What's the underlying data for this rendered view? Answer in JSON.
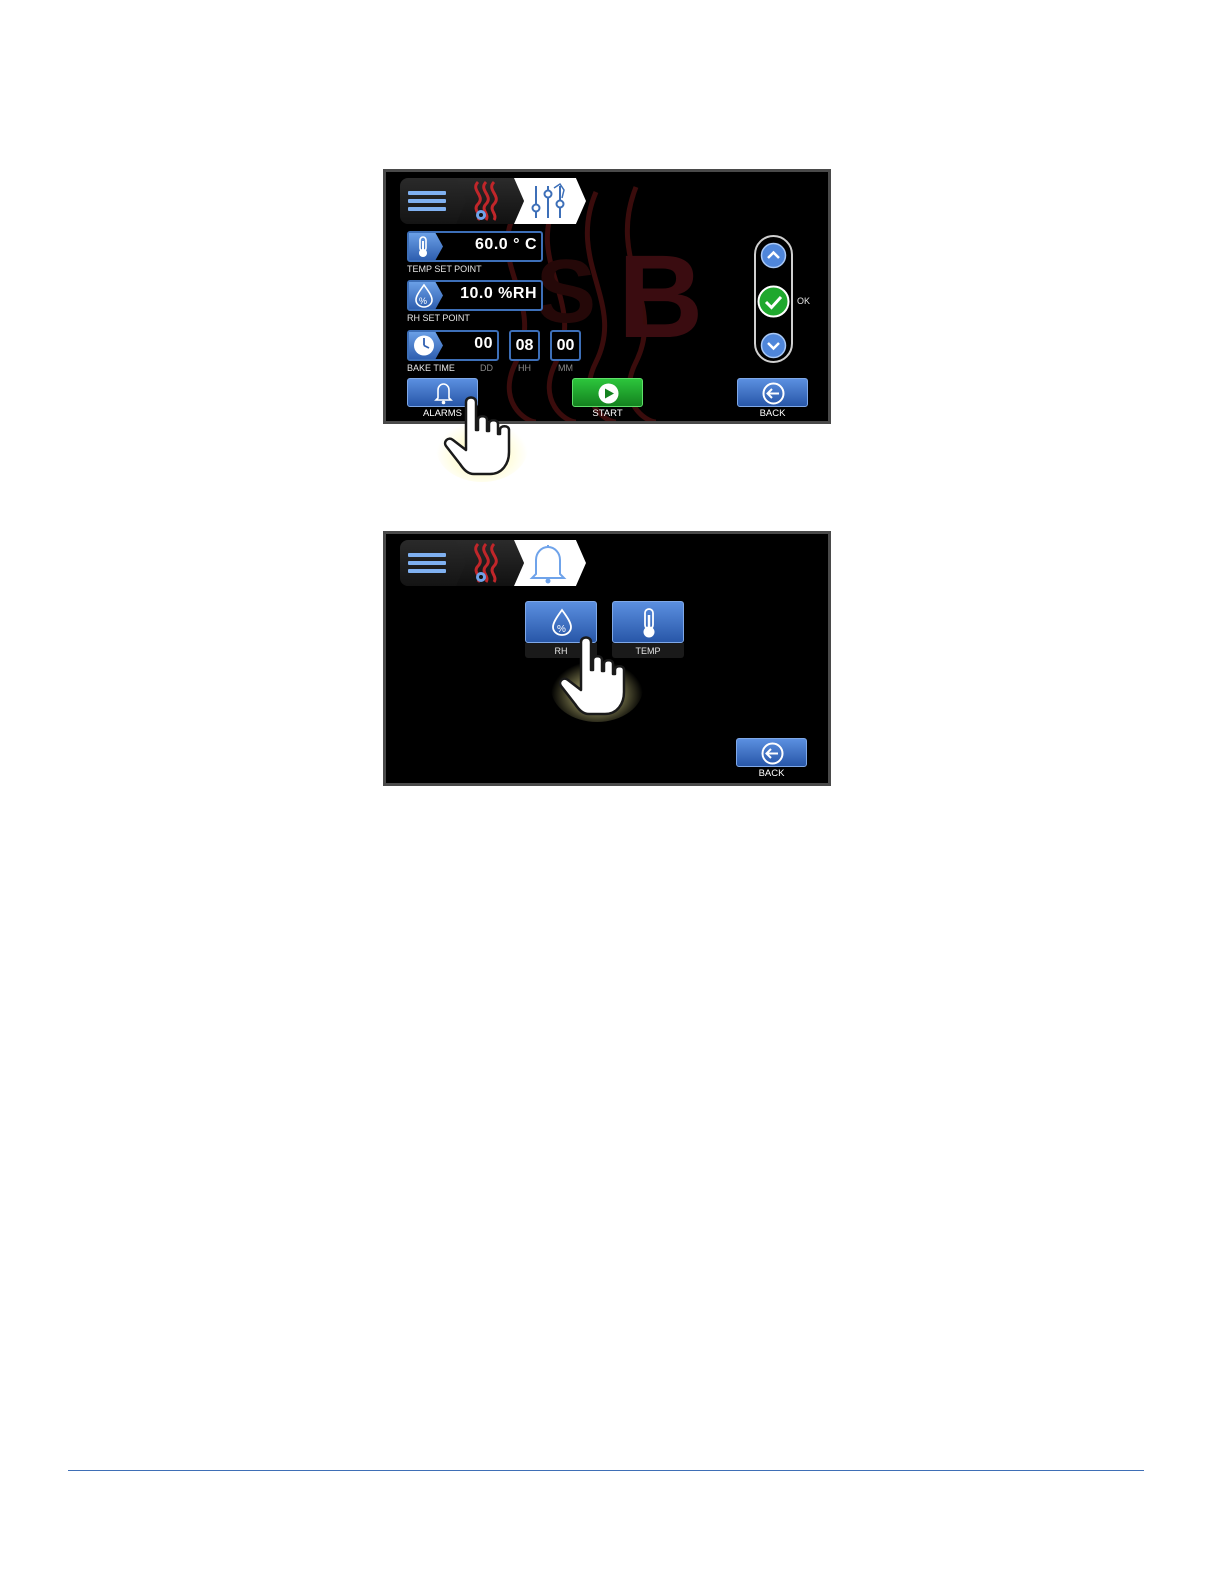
{
  "screen1": {
    "breadcrumb": {
      "menu_icon": "hamburger-menu-icon",
      "heat_icon": "heat-settings-icon",
      "active_icon": "manual-settings-icon"
    },
    "temp": {
      "value": "60.0 ° C",
      "label": "TEMP SET POINT",
      "icon": "thermometer-icon"
    },
    "rh": {
      "value": "10.0 %RH",
      "label": "RH SET POINT",
      "icon": "humidity-drop-icon"
    },
    "bake": {
      "label": "BAKE TIME",
      "dd": "00",
      "hh": "08",
      "mm": "00",
      "dd_label": "DD",
      "hh_label": "HH",
      "mm_label": "MM",
      "icon": "clock-icon"
    },
    "ok_label": "OK",
    "buttons": {
      "alarms": "ALARMS",
      "start": "START",
      "back": "BACK"
    }
  },
  "screen2": {
    "breadcrumb": {
      "active_icon": "bell-icon"
    },
    "rh_label": "RH",
    "temp_label": "TEMP",
    "back": "BACK"
  },
  "colors": {
    "accent_blue": "#3d6fb8",
    "start_green": "#1fa82e",
    "heat_red": "#c0262a",
    "footer_rule": "#3f6fb6"
  }
}
